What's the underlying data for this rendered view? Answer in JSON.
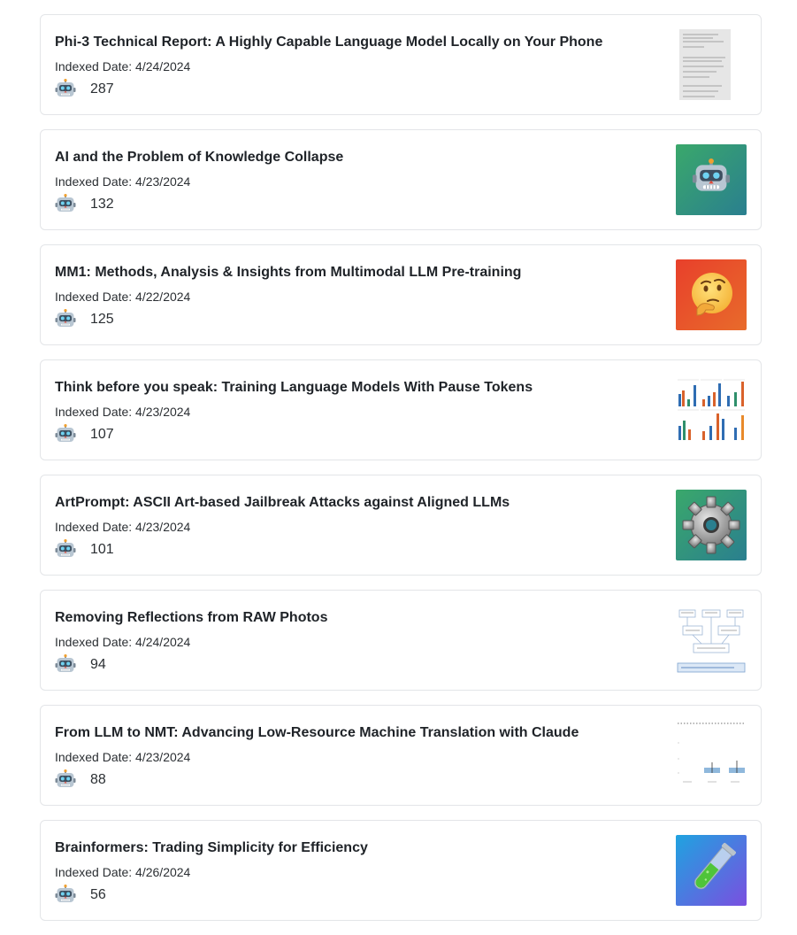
{
  "items": [
    {
      "title": "Phi-3 Technical Report: A Highly Capable Language Model Locally on Your Phone",
      "date": "Indexed Date: 4/24/2024",
      "count": "287",
      "thumb_icon": "document-page-thumbnail"
    },
    {
      "title": "AI and the Problem of Knowledge Collapse",
      "date": "Indexed Date: 4/23/2024",
      "count": "132",
      "thumb_icon": "robot-emoji-icon"
    },
    {
      "title": "MM1: Methods, Analysis & Insights from Multimodal LLM Pre-training",
      "date": "Indexed Date: 4/22/2024",
      "count": "125",
      "thumb_icon": "thinking-face-emoji-icon"
    },
    {
      "title": "Think before you speak: Training Language Models With Pause Tokens",
      "date": "Indexed Date: 4/23/2024",
      "count": "107",
      "thumb_icon": "bar-charts-thumbnail"
    },
    {
      "title": "ArtPrompt: ASCII Art-based Jailbreak Attacks against Aligned LLMs",
      "date": "Indexed Date: 4/23/2024",
      "count": "101",
      "thumb_icon": "gear-emoji-icon"
    },
    {
      "title": "Removing Reflections from RAW Photos",
      "date": "Indexed Date: 4/24/2024",
      "count": "94",
      "thumb_icon": "diagram-thumbnail"
    },
    {
      "title": "From LLM to NMT: Advancing Low-Resource Machine Translation with Claude",
      "date": "Indexed Date: 4/23/2024",
      "count": "88",
      "thumb_icon": "chart-thumbnail"
    },
    {
      "title": "Brainformers: Trading Simplicity for Efficiency",
      "date": "Indexed Date: 4/26/2024",
      "count": "56",
      "thumb_icon": "test-tube-emoji-icon"
    }
  ],
  "colors": {
    "border": "#e3e5e8",
    "title": "#1f2328",
    "robot_thumb_bg": [
      "#3aa86b",
      "#2a7f8f"
    ],
    "thinking_thumb_bg": [
      "#e8402b",
      "#e86b2b"
    ],
    "test_tube_thumb_bg": [
      "#1fa3e0",
      "#7a4fe0"
    ]
  }
}
